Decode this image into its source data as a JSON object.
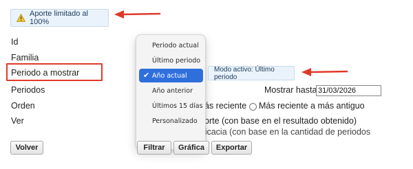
{
  "badge": {
    "text": "Aporte limitado al 100%",
    "icon": "warning-icon"
  },
  "labels": {
    "id": "Id",
    "familia": "Familia",
    "periodo_mostrar": "Periodo a mostrar",
    "periodos": "Periodos",
    "orden": "Orden",
    "ver": "Ver"
  },
  "dropdown": {
    "options": [
      "Periodo actual",
      "Último periodo",
      "Año actual",
      "Año anterior",
      "Últimos 15 días",
      "Personalizado"
    ],
    "selected": "Año actual"
  },
  "modo_activo": "Modo activo: Último periodo",
  "mostrar_hasta": {
    "label": "Mostrar hasta",
    "value": "31/03/2026"
  },
  "orden": {
    "opt1_partial": "ás reciente",
    "opt2": "Más reciente a más antiguo"
  },
  "ver": {
    "opt1_partial": "orte (con base en el resultado obtenido)",
    "opt2_partial": "Indicador de eficacia (con base en la cantidad de periodos cumplidos)"
  },
  "buttons": {
    "volver": "Volver",
    "filtrar": "Filtrar",
    "grafica": "Gráfica",
    "exportar": "Exportar"
  },
  "colors": {
    "highlight": "#e0392b",
    "selected": "#2f6fdc",
    "badge_bg": "#eaf3fb"
  }
}
